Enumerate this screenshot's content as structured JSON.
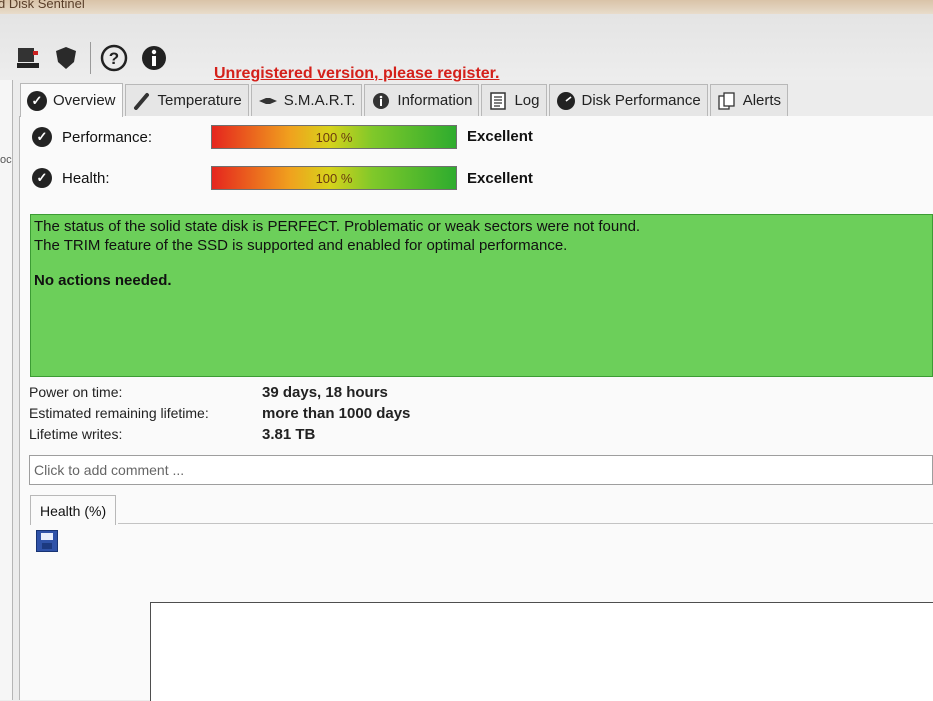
{
  "window": {
    "title_fragment": "d Disk Sentinel"
  },
  "toolbar": {
    "icons": [
      "disk-icon",
      "shield-icon",
      "help-icon",
      "info-icon"
    ],
    "register_link": "Unregistered version, please register."
  },
  "left_strip": {
    "fragment": "oc"
  },
  "tabs": [
    {
      "label": "Overview",
      "icon": "check-icon"
    },
    {
      "label": "Temperature",
      "icon": "thermometer-icon"
    },
    {
      "label": "S.M.A.R.T.",
      "icon": "wrench-icon"
    },
    {
      "label": "Information",
      "icon": "info-icon"
    },
    {
      "label": "Log",
      "icon": "log-icon"
    },
    {
      "label": "Disk Performance",
      "icon": "performance-icon"
    },
    {
      "label": "Alerts",
      "icon": "alerts-icon"
    }
  ],
  "overview": {
    "performance": {
      "label": "Performance:",
      "percent_text": "100 %",
      "percent": 100,
      "rating": "Excellent"
    },
    "health": {
      "label": "Health:",
      "percent_text": "100 %",
      "percent": 100,
      "rating": "Excellent"
    },
    "status": {
      "line1": "The status of the solid state disk is PERFECT. Problematic or weak sectors were not found.",
      "line2": "The TRIM feature of the SSD is supported and enabled for optimal performance.",
      "line3": "No actions needed.",
      "background_color": "#6ccf5a"
    },
    "info": [
      {
        "key": "Power on time:",
        "value": "39 days, 18 hours"
      },
      {
        "key": "Estimated remaining lifetime:",
        "value": "more than 1000 days"
      },
      {
        "key": "Lifetime writes:",
        "value": "3.81 TB"
      }
    ],
    "comment": {
      "placeholder": "Click to add comment ..."
    },
    "subtab": {
      "label": "Health (%)"
    }
  },
  "colors": {
    "register_link": "#d4201a",
    "status_green": "#6ccf5a"
  }
}
